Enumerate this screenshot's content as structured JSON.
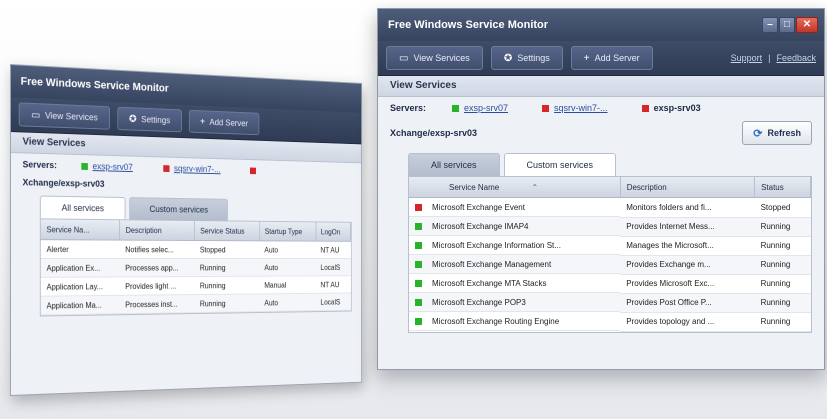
{
  "app": {
    "title": "Free Windows Service Monitor",
    "toolbar": {
      "view_services": "View Services",
      "settings": "Settings",
      "add_server": "Add Server",
      "support": "Support",
      "feedback": "Feedback",
      "separator": "|"
    },
    "section_title": "View Services",
    "servers_label": "Servers:",
    "servers": [
      {
        "name": "exsp-srv07",
        "status": "green"
      },
      {
        "name": "sqsrv-win7-...",
        "status": "red"
      },
      {
        "name": "exsp-srv03",
        "status": "red"
      }
    ],
    "path": "Xchange/exsp-srv03",
    "refresh": "Refresh",
    "tabs": [
      "All services",
      "Custom services"
    ],
    "front_columns": [
      "Service Name",
      "Description",
      "Status"
    ],
    "front_rows": [
      {
        "name": "Microsoft Exchange Event",
        "desc": "Monitors folders and fi...",
        "status": "Stopped",
        "color": "red"
      },
      {
        "name": "Microsoft Exchange IMAP4",
        "desc": "Provides Internet Mess...",
        "status": "Running",
        "color": "green"
      },
      {
        "name": "Microsoft Exchange Information St...",
        "desc": "Manages the Microsoft...",
        "status": "Running",
        "color": "green"
      },
      {
        "name": "Microsoft Exchange Management",
        "desc": "Provides Exchange m...",
        "status": "Running",
        "color": "green"
      },
      {
        "name": "Microsoft Exchange MTA Stacks",
        "desc": "Provides Microsoft Exc...",
        "status": "Running",
        "color": "green"
      },
      {
        "name": "Microsoft Exchange POP3",
        "desc": "Provides Post Office P...",
        "status": "Running",
        "color": "green"
      },
      {
        "name": "Microsoft Exchange Routing Engine",
        "desc": "Provides topology and ...",
        "status": "Running",
        "color": "green"
      }
    ],
    "back_columns": [
      "Service Na...",
      "Description",
      "Service Status",
      "Startup Type",
      "LogOn"
    ],
    "back_rows": [
      {
        "name": "Alerter",
        "desc": "Notifies selec...",
        "status": "Stopped",
        "startup": "Auto",
        "logon": "NT AU"
      },
      {
        "name": "Application Ex...",
        "desc": "Processes app...",
        "status": "Running",
        "startup": "Auto",
        "logon": "LocalS"
      },
      {
        "name": "Application Lay...",
        "desc": "Provides light ...",
        "status": "Running",
        "startup": "Manual",
        "logon": "NT AU"
      },
      {
        "name": "Application Ma...",
        "desc": "Processes inst...",
        "status": "Running",
        "startup": "Auto",
        "logon": "LocalS"
      }
    ],
    "colors": {
      "accent": "#364460",
      "running": "#27b42b",
      "stopped": "#d7262b"
    }
  }
}
